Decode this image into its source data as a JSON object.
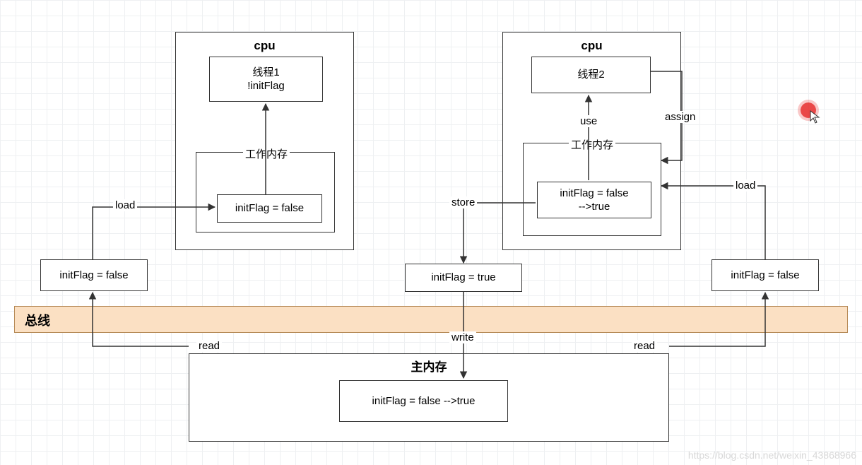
{
  "cpu1": {
    "title": "cpu",
    "thread_line1": "线程1",
    "thread_line2": "!initFlag",
    "workmem_label": "工作内存",
    "var": "initFlag = false"
  },
  "cpu2": {
    "title": "cpu",
    "thread": "线程2",
    "workmem_label": "工作内存",
    "var_line1": "initFlag = false",
    "var_line2": "-->true"
  },
  "snapshots": {
    "left": "initFlag = false",
    "center": "initFlag = true",
    "right": "initFlag = false"
  },
  "bus_label": "总线",
  "main_mem": {
    "title": "主内存",
    "var": "initFlag = false -->true"
  },
  "edges": {
    "load_left": "load",
    "read_left": "read",
    "store": "store",
    "write": "write",
    "use": "use",
    "assign": "assign",
    "load_right": "load",
    "read_right": "read"
  },
  "watermark": "https://blog.csdn.net/weixin_43868966"
}
